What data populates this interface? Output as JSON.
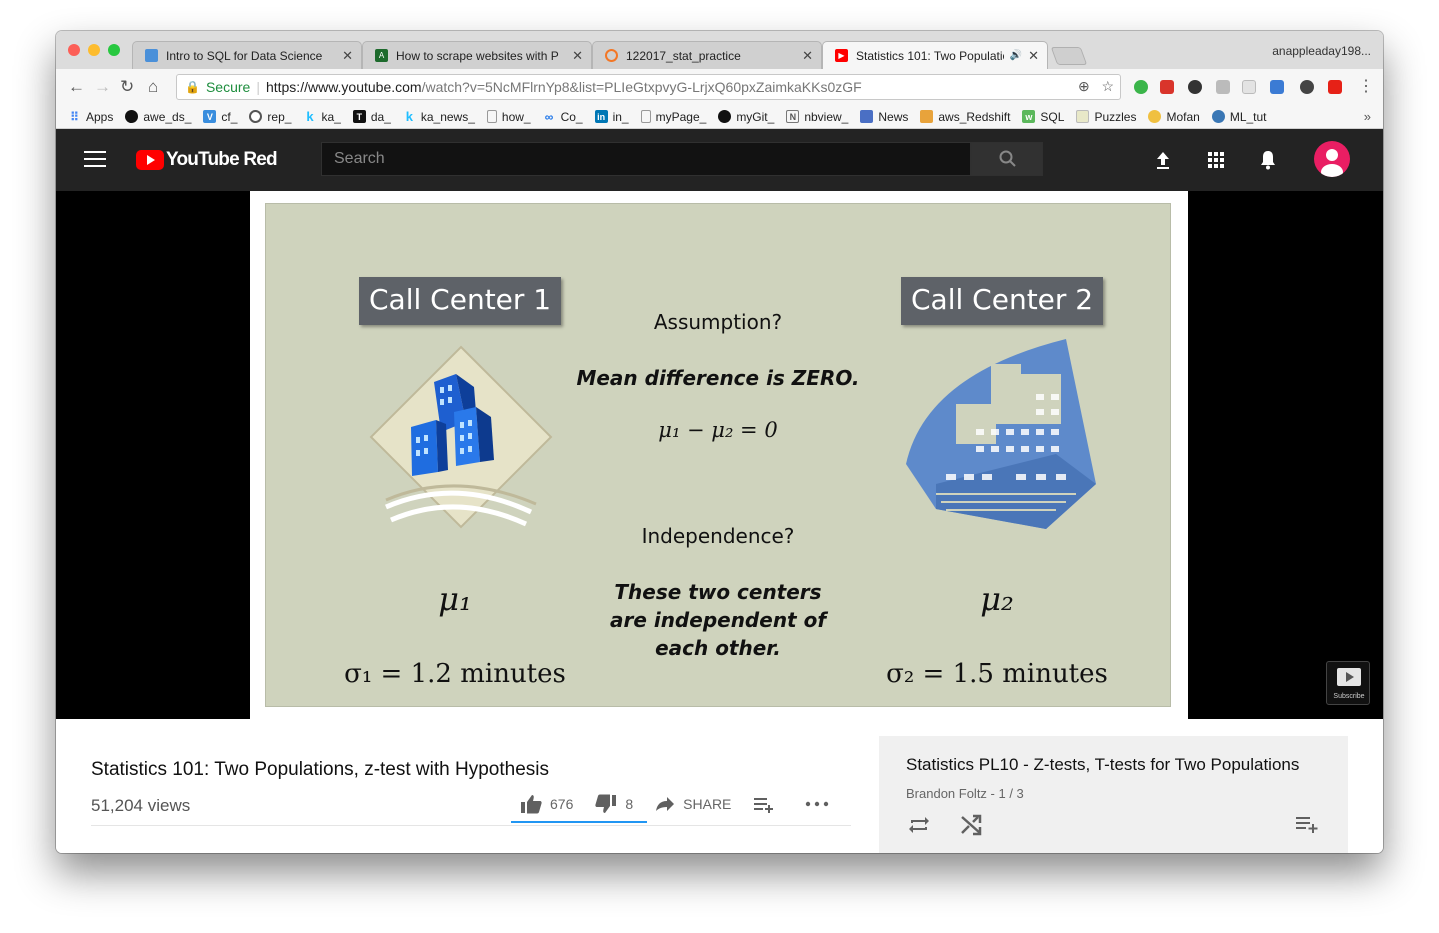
{
  "browser": {
    "tabs": [
      {
        "title": "Intro to SQL for Data Science",
        "active": false
      },
      {
        "title": "How to scrape websites with P",
        "active": false
      },
      {
        "title": "122017_stat_practice",
        "active": false
      },
      {
        "title": "Statistics 101: Two Populatio",
        "active": true
      }
    ],
    "profile_name": "anappleaday198...",
    "secure_label": "Secure",
    "url_host": "https://www.youtube.com",
    "url_rest": "/watch?v=5NcMFlrnYp8&list=PLIeGtxpvyG-LrjxQ60pxZaimkaKKs0zGF",
    "bookmarks": [
      {
        "label": "Apps",
        "icon": "apps-grid-icon"
      },
      {
        "label": "awe_ds_",
        "icon": "github-icon"
      },
      {
        "label": "cf_",
        "icon": "vt-icon"
      },
      {
        "label": "rep_",
        "icon": "rep-icon"
      },
      {
        "label": "ka_",
        "icon": "k-icon"
      },
      {
        "label": "da_",
        "icon": "t-icon"
      },
      {
        "label": "ka_news_",
        "icon": "k-icon"
      },
      {
        "label": "how_",
        "icon": "page-icon"
      },
      {
        "label": "Co_",
        "icon": "co-icon"
      },
      {
        "label": "in_",
        "icon": "linkedin-icon"
      },
      {
        "label": "myPage_",
        "icon": "page-icon"
      },
      {
        "label": "myGit_",
        "icon": "github-icon"
      },
      {
        "label": "nbview_",
        "icon": "nb-icon"
      },
      {
        "label": "News",
        "icon": "news-icon"
      },
      {
        "label": "aws_Redshift",
        "icon": "aws-icon"
      },
      {
        "label": "SQL",
        "icon": "sql-icon"
      },
      {
        "label": "Puzzles",
        "icon": "folder-icon"
      },
      {
        "label": "Mofan",
        "icon": "python-icon"
      },
      {
        "label": "ML_tut",
        "icon": "python-icon"
      }
    ],
    "more_bookmarks": "»"
  },
  "youtube": {
    "logo_text": "YouTube Red",
    "search_placeholder": "Search"
  },
  "slide": {
    "left_label": "Call Center 1",
    "right_label": "Call Center 2",
    "assumption": "Assumption?",
    "mean_diff": "Mean difference is ZERO.",
    "equation": "μ₁ − μ₂ = 0",
    "independence": "Independence?",
    "indep_line1": "These two centers",
    "indep_line2": "are independent of",
    "indep_line3": "each other.",
    "mu1": "μ₁",
    "mu2": "μ₂",
    "sigma1": "σ₁ = 1.2 minutes",
    "sigma2": "σ₂ = 1.5 minutes",
    "subscribe_label": "Subscribe"
  },
  "video": {
    "title": "Statistics 101: Two Populations, z-test with Hypothesis",
    "views": "51,204 views",
    "likes": "676",
    "dislikes": "8",
    "share_label": "SHARE"
  },
  "playlist": {
    "title": "Statistics PL10 - Z-tests, T-tests for Two Populations",
    "subtitle": "Brandon Foltz - 1 / 3"
  },
  "colors": {
    "youtube_red": "#ff0000",
    "header_bg": "#232323",
    "slide_bg": "#cfd3bd",
    "like_bar": "#2196f3",
    "avatar": "#e91e63"
  }
}
